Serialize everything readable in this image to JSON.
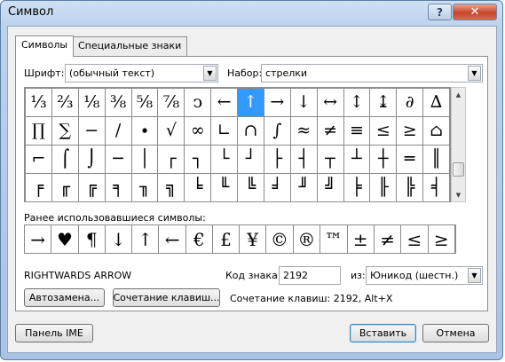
{
  "window": {
    "title": "Символ",
    "help_label": "?",
    "close_label": "✕"
  },
  "tabs": [
    {
      "label": "Символы"
    },
    {
      "label": "Специальные знаки"
    }
  ],
  "font": {
    "label": "Шрифт:",
    "value": "(обычный текст)"
  },
  "subset": {
    "label": "Набор:",
    "value": "стрелки"
  },
  "symbol_grid": {
    "selected_row": 0,
    "selected_col": 8,
    "rows": [
      [
        "⅓",
        "⅔",
        "⅛",
        "⅜",
        "⅝",
        "⅞",
        "ↄ",
        "←",
        "↑",
        "→",
        "↓",
        "↔",
        "↕",
        "↨",
        "∂",
        "∆"
      ],
      [
        "∏",
        "∑",
        "−",
        "∕",
        "∙",
        "√",
        "∞",
        "∟",
        "∩",
        "∫",
        "≈",
        "≠",
        "≡",
        "≤",
        "≥",
        "⌂"
      ],
      [
        "⌐",
        "⌠",
        "⌡",
        "─",
        "│",
        "┌",
        "┐",
        "└",
        "┘",
        "├",
        "┤",
        "┬",
        "┴",
        "┼",
        "═",
        "║"
      ],
      [
        "╒",
        "╓",
        "╔",
        "╕",
        "╖",
        "╗",
        "╘",
        "╙",
        "╚",
        "╛",
        "╜",
        "╝",
        "╞",
        "╟",
        "╠",
        "╡"
      ]
    ]
  },
  "recent": {
    "label": "Ранее использовавшиеся символы:",
    "symbols": [
      "→",
      "♥",
      "¶",
      "↓",
      "↑",
      "←",
      "€",
      "£",
      "¥",
      "©",
      "®",
      "™",
      "±",
      "≠",
      "≤",
      "≥"
    ]
  },
  "char_name": "RIGHTWARDS ARROW",
  "code": {
    "label": "Код знака:",
    "value": "2192"
  },
  "from": {
    "label": "из:",
    "value": "Юникод (шестн.)"
  },
  "buttons": {
    "autocorrect": "Автозамена...",
    "shortcut_key": "Сочетание клавиш...",
    "ime_pad": "Панель IME",
    "insert": "Вставить",
    "cancel": "Отмена"
  },
  "shortcut_text": "Сочетание клавиш: 2192, Alt+X"
}
